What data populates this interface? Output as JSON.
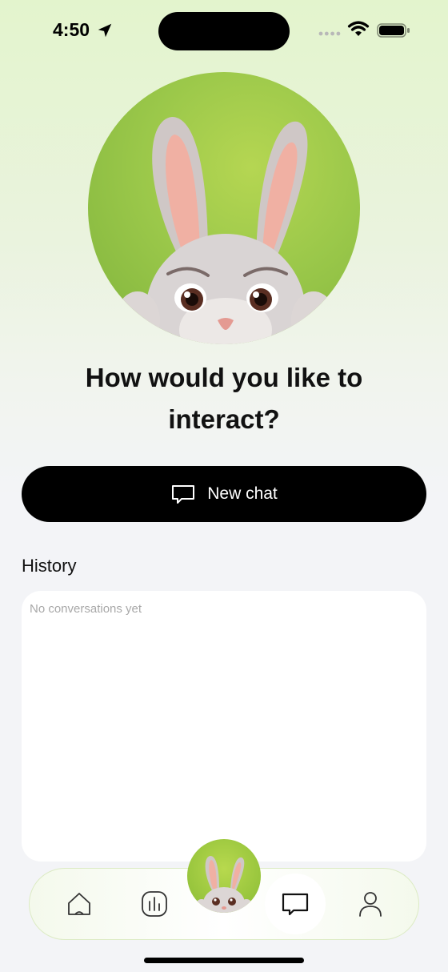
{
  "status_bar": {
    "time": "4:50"
  },
  "hero": {
    "avatar_icon": "bunny-mascot"
  },
  "heading": "How would you like to interact?",
  "new_chat": {
    "label": "New chat",
    "icon": "chat-bubble-icon"
  },
  "history": {
    "title": "History",
    "empty_text": "No conversations yet"
  },
  "tabbar": {
    "items": [
      {
        "name": "home",
        "icon": "home-icon"
      },
      {
        "name": "stats",
        "icon": "bar-chart-icon"
      },
      {
        "name": "assistant",
        "icon": "bunny-mascot"
      },
      {
        "name": "chat",
        "icon": "chat-bubble-icon",
        "active": true
      },
      {
        "name": "profile",
        "icon": "person-icon"
      }
    ]
  },
  "colors": {
    "accent_green": "#9bc84a",
    "button_bg": "#000000",
    "card_bg": "#ffffff"
  }
}
